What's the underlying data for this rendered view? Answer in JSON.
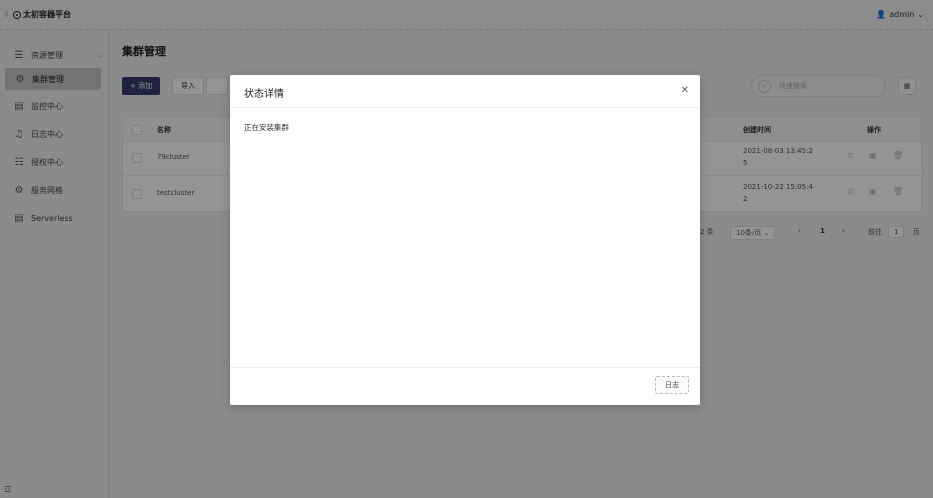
{
  "app": {
    "title": "太初容器平台",
    "user": "admin"
  },
  "sidebar": {
    "items": [
      {
        "label": "资源管理",
        "icon": "sliders-icon",
        "active": false,
        "has_chevron": true
      },
      {
        "label": "集群管理",
        "icon": "gear-icon",
        "active": true
      },
      {
        "label": "监控中心",
        "icon": "monitor-icon",
        "active": false
      },
      {
        "label": "日志中心",
        "icon": "bell-icon",
        "active": false
      },
      {
        "label": "授权中心",
        "icon": "list-icon",
        "active": false
      },
      {
        "label": "服务网格",
        "icon": "mesh-icon",
        "active": false
      },
      {
        "label": "Serverless",
        "icon": "document-icon",
        "active": false
      }
    ]
  },
  "main": {
    "title": "集群管理",
    "toolbar": {
      "add_label": "+ 添加",
      "import_label": "导入"
    },
    "search": {
      "placeholder": "快速搜索"
    },
    "table": {
      "columns": {
        "name": "名称",
        "created": "创建时间",
        "actions": "操作"
      },
      "rows": [
        {
          "name": "79cluster",
          "created_line1": "2021-08-03 13:45:2",
          "created_line2": "5"
        },
        {
          "name": "testcluster",
          "created_line1": "2021-10-22 15:05:4",
          "created_line2": "2"
        }
      ]
    },
    "pagination": {
      "total_text": "2 条",
      "page_size": "10条/页",
      "current_page": "1",
      "goto_label": "前往",
      "goto_value": "1",
      "page_unit": "页"
    }
  },
  "modal": {
    "title": "状态详情",
    "body": "正在安装集群",
    "log_button": "日志"
  },
  "colors": {
    "primary": "#3a3a70",
    "overlay": "rgba(0,0,0,0.42)"
  }
}
